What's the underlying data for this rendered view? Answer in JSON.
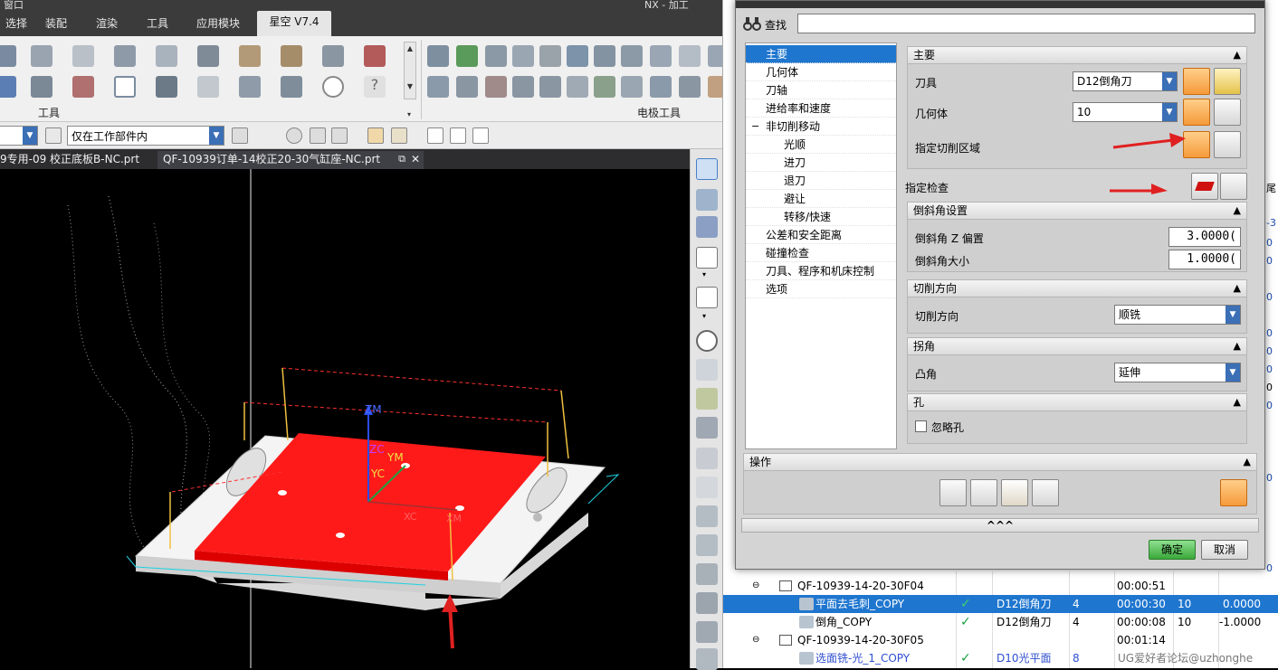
{
  "menubar": {
    "top_fragment": "窗口",
    "tabs": [
      "选择",
      "装配",
      "渲染",
      "工具",
      "应用模块",
      "星空 V7.4"
    ],
    "title_fragment": "NX - 加工"
  },
  "ribbon": {
    "group_left_label": "工具",
    "group_right_label": "电极工具"
  },
  "selection_bar": {
    "filter_value": "",
    "scope_value": "仅在工作部件内"
  },
  "doc_tabs": [
    {
      "label": "9专用-09 校正底板B-NC.prt"
    },
    {
      "label": "QF-10939订单-14校正20-30气缸座-NC.prt"
    }
  ],
  "viewport": {
    "axis_labels": [
      "ZM",
      "ZC",
      "YM",
      "YC",
      "XC",
      "XM"
    ]
  },
  "dialog": {
    "find_label": "查找",
    "find_value": "",
    "tree": [
      {
        "label": "主要",
        "level": 0,
        "selected": true
      },
      {
        "label": "几何体",
        "level": 0
      },
      {
        "label": "刀轴",
        "level": 0
      },
      {
        "label": "进给率和速度",
        "level": 0
      },
      {
        "label": "非切削移动",
        "level": 0,
        "expander": "−"
      },
      {
        "label": "光顺",
        "level": 1
      },
      {
        "label": "进刀",
        "level": 1
      },
      {
        "label": "退刀",
        "level": 1
      },
      {
        "label": "避让",
        "level": 1
      },
      {
        "label": "转移/快速",
        "level": 1
      },
      {
        "label": "公差和安全距离",
        "level": 0
      },
      {
        "label": "碰撞检查",
        "level": 0
      },
      {
        "label": "刀具、程序和机床控制",
        "level": 0
      },
      {
        "label": "选项",
        "level": 0
      }
    ],
    "main": {
      "header": "主要",
      "tool_label": "刀具",
      "tool_value": "D12倒角刀",
      "geometry_label": "几何体",
      "geometry_value": "10",
      "cut_area_label": "指定切削区域",
      "check_label": "指定检查"
    },
    "chamfer": {
      "header": "倒斜角设置",
      "z_offset_label": "倒斜角 Z 偏置",
      "z_offset_value": "3.0000(",
      "size_label": "倒斜角大小",
      "size_value": "1.0000("
    },
    "cut_direction": {
      "header": "切削方向",
      "label": "切削方向",
      "value": "顺铣"
    },
    "corner": {
      "header": "拐角",
      "label": "凸角",
      "value": "延伸"
    },
    "hole": {
      "header": "孔",
      "ignore_label": "忽略孔",
      "ignore_checked": false
    },
    "operations_header": "操作",
    "more_label": "^^^",
    "ok_label": "确定",
    "cancel_label": "取消"
  },
  "navigator": {
    "rows": [
      {
        "name": "QF-10939-14-20-30F04",
        "tool": "",
        "num": "",
        "time": "00:00:51",
        "a": "",
        "b": "",
        "kind": "program"
      },
      {
        "name": "平面去毛刺_COPY",
        "tool": "D12倒角刀",
        "num": "4",
        "time": "00:00:30",
        "a": "10",
        "b": "0.0000",
        "kind": "op",
        "selected": true
      },
      {
        "name": "倒角_COPY",
        "tool": "D12倒角刀",
        "num": "4",
        "time": "00:00:08",
        "a": "10",
        "b": "-1.0000",
        "kind": "op"
      },
      {
        "name": "QF-10939-14-20-30F05",
        "tool": "",
        "num": "",
        "time": "00:01:14",
        "a": "",
        "b": "",
        "kind": "program"
      },
      {
        "name": "选面铣-光_1_COPY",
        "tool": "D10光平面",
        "num": "8",
        "time": "",
        "a": "",
        "b": "",
        "kind": "op"
      }
    ],
    "side_fragments": [
      "尾",
      "-3",
      "0",
      "0",
      "0",
      "0",
      "0",
      "0",
      "0",
      "0",
      "0",
      "0"
    ]
  },
  "watermark": "UG爱好者论坛@uzhonghe",
  "colors": {
    "selection_blue": "#1f76cf",
    "part_red": "#ff1a1a",
    "accent_orange": "#f59a3a"
  }
}
